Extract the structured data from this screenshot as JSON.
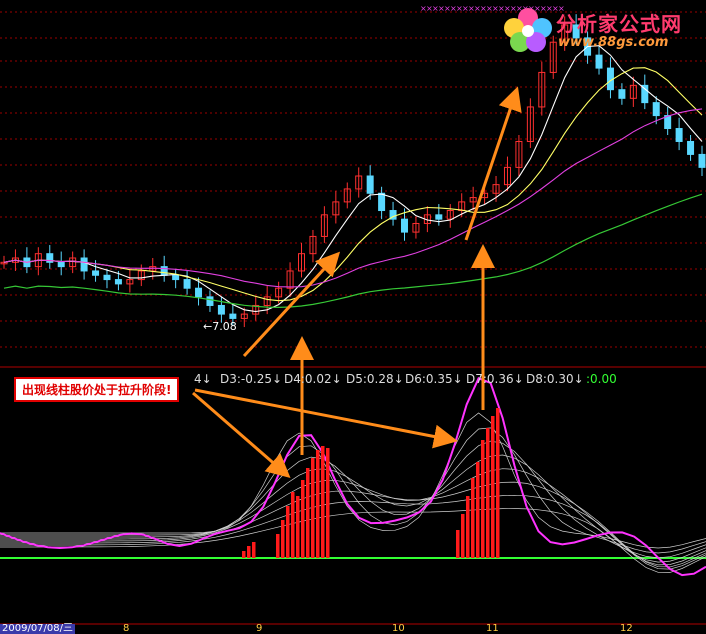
{
  "logo": {
    "main": "分析家公式网",
    "sub": "www.88gs.com"
  },
  "price_panel": {
    "low_marker": "←7.08"
  },
  "annotation": {
    "text": "出现线柱股价处于拉升阶段!"
  },
  "indicator_labels": [
    {
      "text": "4↓"
    },
    {
      "text": "D3:-0.25↓"
    },
    {
      "text": "D4:0.02↓"
    },
    {
      "text": "D5:0.28↓"
    },
    {
      "text": "D6:0.35↓"
    },
    {
      "text": "D7:0.36↓"
    },
    {
      "text": "D8:0.30↓"
    },
    {
      "text": ":0.00"
    }
  ],
  "time_axis": {
    "date": "2009/07/08/三",
    "months": [
      "8",
      "9",
      "10",
      "11",
      "12"
    ]
  },
  "colors": {
    "up_candle": "#ff3030",
    "down_candle": "#5ad8ff",
    "ma_white": "#ffffff",
    "ma_yellow": "#ffff66",
    "ma_magenta": "#e040e0",
    "ma_green": "#36c836",
    "histogram": "#ff1a1a",
    "indicator_main": "#ff33ff",
    "indicator_lines": "#cfcfcf",
    "zero_line": "#33ff33",
    "arrow": "#ff8c1a",
    "grid": "#9a0000"
  },
  "chart_data": [
    {
      "type": "candlestick",
      "title": "",
      "annotations": [
        "←7.08"
      ],
      "series": [
        {
          "values": [
            8.4,
            8.5,
            8.3,
            8.6,
            8.4,
            8.3,
            8.5,
            8.2,
            8.1,
            8.0,
            7.9,
            8.0,
            8.2,
            8.3,
            8.1,
            8.0,
            7.8,
            7.6,
            7.4,
            7.2,
            7.1,
            7.2,
            7.4,
            7.6,
            7.8,
            8.2,
            8.6,
            9.0,
            9.5,
            9.8,
            10.1,
            10.4,
            10.0,
            9.6,
            9.4,
            9.1,
            9.3,
            9.5,
            9.4,
            9.6,
            9.8,
            9.9,
            10.0,
            10.2,
            10.6,
            11.2,
            12.0,
            12.8,
            13.5,
            13.9,
            13.6,
            13.2,
            12.9,
            12.4,
            12.2,
            12.5,
            12.1,
            11.8,
            11.5,
            11.2,
            10.9,
            10.6
          ]
        }
      ]
    },
    {
      "type": "bar",
      "title": "",
      "series": [
        {
          "name": "D3",
          "values": [
            -0.25
          ]
        },
        {
          "name": "D4",
          "values": [
            0.02
          ]
        },
        {
          "name": "D5",
          "values": [
            0.28
          ]
        },
        {
          "name": "D6",
          "values": [
            0.35
          ]
        },
        {
          "name": "D7",
          "values": [
            0.36
          ]
        },
        {
          "name": "D8",
          "values": [
            0.3
          ]
        }
      ]
    }
  ]
}
